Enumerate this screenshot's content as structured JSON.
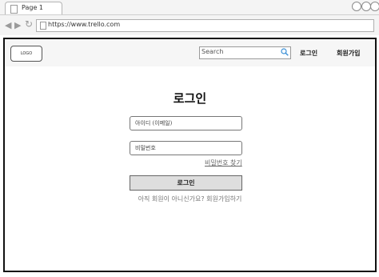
{
  "browser": {
    "tab_title": "Page 1",
    "url": "https://www.trello.com"
  },
  "header": {
    "logo": "LOGO",
    "search_placeholder": "Search",
    "login_link": "로그인",
    "signup_link": "회원가입"
  },
  "login_form": {
    "title": "로그인",
    "id_field": "아이디 (이메일)",
    "password_field": "비밀번호",
    "find_password": "비밀번호 찾기",
    "submit": "로그인",
    "signup_prompt": "아직 회원이 아니신가요?",
    "signup_link": "회원가입하기"
  },
  "icons": {
    "search": "search-icon",
    "back": "arrow-left-icon",
    "forward": "arrow-right-icon",
    "reload": "reload-icon"
  }
}
